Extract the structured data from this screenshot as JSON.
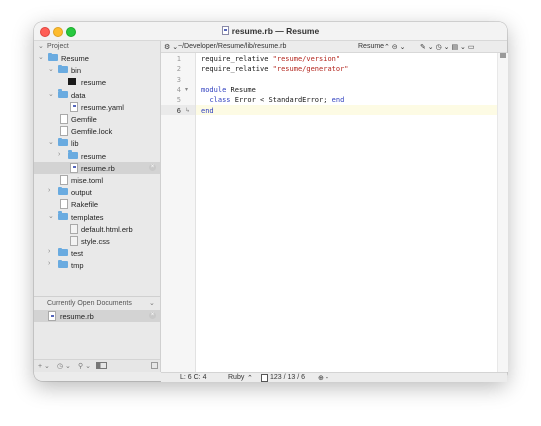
{
  "window": {
    "title": "resume.rb — Resume"
  },
  "sidebar": {
    "project_header": "Project",
    "tree": [
      {
        "label": "Resume",
        "kind": "folder",
        "depth": 0,
        "disclosure": "open"
      },
      {
        "label": "bin",
        "kind": "folder",
        "depth": 1,
        "disclosure": "open"
      },
      {
        "label": "resume",
        "kind": "exec",
        "depth": 2
      },
      {
        "label": "data",
        "kind": "folder",
        "depth": 1,
        "disclosure": "open"
      },
      {
        "label": "resume.yaml",
        "kind": "ruby",
        "depth": 2
      },
      {
        "label": "Gemfile",
        "kind": "file",
        "depth": 1
      },
      {
        "label": "Gemfile.lock",
        "kind": "file",
        "depth": 1
      },
      {
        "label": "lib",
        "kind": "folder",
        "depth": 1,
        "disclosure": "open"
      },
      {
        "label": "resume",
        "kind": "folder",
        "depth": 2,
        "disclosure": "closed"
      },
      {
        "label": "resume.rb",
        "kind": "ruby",
        "depth": 2,
        "selected": true,
        "closable": true
      },
      {
        "label": "mise.toml",
        "kind": "file",
        "depth": 1
      },
      {
        "label": "output",
        "kind": "folder",
        "depth": 1,
        "disclosure": "closed"
      },
      {
        "label": "Rakefile",
        "kind": "file",
        "depth": 1
      },
      {
        "label": "templates",
        "kind": "folder",
        "depth": 1,
        "disclosure": "open"
      },
      {
        "label": "default.html.erb",
        "kind": "file-gray",
        "depth": 2
      },
      {
        "label": "style.css",
        "kind": "file-gray",
        "depth": 2
      },
      {
        "label": "test",
        "kind": "folder",
        "depth": 1,
        "disclosure": "closed"
      },
      {
        "label": "tmp",
        "kind": "folder",
        "depth": 1,
        "disclosure": "closed"
      }
    ],
    "open_docs_header": "Currently Open Documents",
    "open_docs": [
      {
        "label": "resume.rb",
        "selected": true
      }
    ],
    "footer": {
      "add": "+ ⌄",
      "history": "◷ ⌄",
      "filter": "⚲ ⌄"
    }
  },
  "pathbar": {
    "gear": "⚙ ⌄",
    "path": "~/Developer/Resume/lib/resume.rb",
    "symbol": "Resume",
    "symbol_controls": "⌃ ⊝ ⌄",
    "tools": "✎ ⌄   ◷ ⌄   ▤ ⌄  ▭"
  },
  "editor": {
    "current_line": 6,
    "lines": [
      {
        "n": "1",
        "segments": [
          {
            "t": "require_relative ",
            "c": "plain"
          },
          {
            "t": "\"resume/version\"",
            "c": "str"
          }
        ]
      },
      {
        "n": "2",
        "segments": [
          {
            "t": "require_relative ",
            "c": "plain"
          },
          {
            "t": "\"resume/generator\"",
            "c": "str"
          }
        ]
      },
      {
        "n": "3",
        "segments": []
      },
      {
        "n": "4",
        "mark": "▾",
        "segments": [
          {
            "t": "module",
            "c": "kw"
          },
          {
            "t": " Resume",
            "c": "plain"
          }
        ]
      },
      {
        "n": "5",
        "segments": [
          {
            "t": "  ",
            "c": "plain"
          },
          {
            "t": "class",
            "c": "kw"
          },
          {
            "t": " Error < StandardError; ",
            "c": "plain"
          },
          {
            "t": "end",
            "c": "kw"
          }
        ]
      },
      {
        "n": "6",
        "mark": "↳",
        "segments": [
          {
            "t": "end",
            "c": "kw"
          }
        ]
      }
    ]
  },
  "statusbar": {
    "position": "L: 6 C: 4",
    "language": "Ruby",
    "language_arrows": "⌃",
    "stats": "123 / 13 / 6",
    "zoom": "⊕ -"
  },
  "colors": {
    "keyword": "#2f3fbf",
    "string": "#b3261e",
    "folder": "#6aabe0",
    "current_line": "#fdfbe4"
  }
}
